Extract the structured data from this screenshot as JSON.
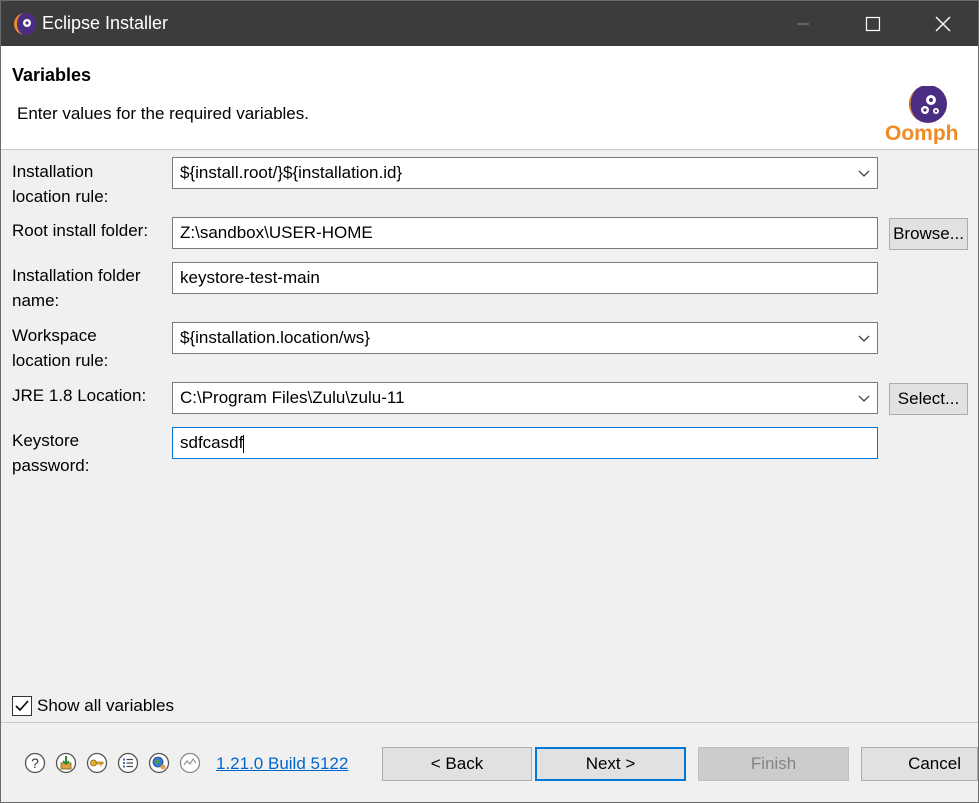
{
  "window": {
    "title": "Eclipse Installer"
  },
  "header": {
    "title": "Variables",
    "description": "Enter values for the required variables.",
    "logo_text": "Oomph"
  },
  "form": {
    "installation_location_rule": {
      "label_line1": "Installation",
      "label_line2": "location rule:",
      "value": "${install.root/}${installation.id}"
    },
    "root_install_folder": {
      "label": "Root install folder:",
      "value": "Z:\\sandbox\\USER-HOME",
      "button": "Browse..."
    },
    "installation_folder_name": {
      "label_line1": "Installation folder",
      "label_line2": "name:",
      "value": "keystore-test-main"
    },
    "workspace_location_rule": {
      "label_line1": "Workspace",
      "label_line2": "location rule:",
      "value": "${installation.location/ws}"
    },
    "jre_location": {
      "label": "JRE 1.8 Location:",
      "value": "C:\\Program Files\\Zulu\\zulu-11",
      "button": "Select..."
    },
    "keystore_password": {
      "label_line1": "Keystore",
      "label_line2": "password:",
      "value": "sdfcasdf"
    }
  },
  "show_all_variables": {
    "label": "Show all variables",
    "checked": true
  },
  "footer": {
    "icons": [
      "help-icon",
      "install-icon",
      "key-icon",
      "list-icon",
      "network-icon",
      "progress-icon"
    ],
    "version": "1.21.0 Build 5122",
    "back_label": "< Back",
    "next_label": "Next >",
    "finish_label": "Finish",
    "cancel_label": "Cancel"
  },
  "colors": {
    "titlebar": "#3c3c3c",
    "accent": "#0078d7",
    "link": "#0066cc",
    "oomph_orange": "#f08a24",
    "oomph_purple": "#4b2d83"
  }
}
